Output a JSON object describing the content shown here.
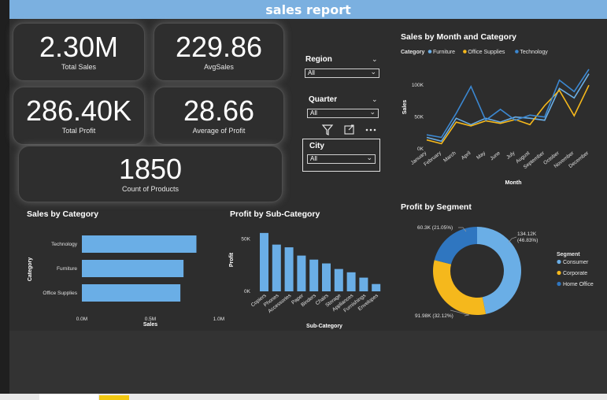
{
  "header": {
    "title": "sales report"
  },
  "kpis": {
    "total_sales": {
      "value": "2.30M",
      "label": "Total Sales"
    },
    "avg_sales": {
      "value": "229.86",
      "label": "AvgSales"
    },
    "total_profit": {
      "value": "286.40K",
      "label": "Total Profit"
    },
    "avg_profit": {
      "value": "28.66",
      "label": "Average of Profit"
    },
    "count_products": {
      "value": "1850",
      "label": "Count of Products"
    }
  },
  "slicers": {
    "region": {
      "label": "Region",
      "value": "All"
    },
    "quarter": {
      "label": "Quarter",
      "value": "All"
    },
    "city": {
      "label": "City",
      "value": "All"
    }
  },
  "icons": [
    "filter-icon",
    "focus-mode-icon",
    "more-options-icon",
    "chevron-down-icon"
  ],
  "colors": {
    "furniture": "#6aaee6",
    "office_supplies": "#f5b81c",
    "technology": "#3b87d0",
    "bar": "#6aaee6",
    "consumer": "#6aaee6",
    "corporate": "#f5b81c",
    "home_office": "#2f76c0"
  },
  "charts": {
    "month_category": {
      "title": "Sales by Month and Category",
      "legend_title": "Category",
      "legend": [
        "Furniture",
        "Office Supplies",
        "Technology"
      ],
      "xlabel": "Month",
      "ylabel": "Sales",
      "yticks": [
        "100K",
        "50K",
        "0K"
      ]
    },
    "category": {
      "title": "Sales by Category",
      "xlabel": "Sales",
      "ylabel": "Category",
      "xticks": [
        "0.0M",
        "0.5M",
        "1.0M"
      ]
    },
    "subcategory": {
      "title": "Profit by Sub-Category",
      "xlabel": "Sub-Category",
      "ylabel": "Profit",
      "yticks": [
        "50K",
        "0K"
      ]
    },
    "segment": {
      "title": "Profit by Segment",
      "legend_title": "Segment",
      "legend": [
        "Consumer",
        "Corporate",
        "Home Office"
      ],
      "labels": {
        "consumer": "134.12K\n(46.83%)",
        "corporate": "91.98K (32.12%)",
        "home_office": "60.3K (21.05%)"
      }
    }
  },
  "chart_data": [
    {
      "type": "line",
      "title": "Sales by Month and Category",
      "xlabel": "Month",
      "ylabel": "Sales",
      "x": [
        "January",
        "February",
        "March",
        "April",
        "May",
        "June",
        "July",
        "August",
        "September",
        "October",
        "November",
        "December"
      ],
      "ylim": [
        0,
        130000
      ],
      "series": [
        {
          "name": "Furniture",
          "values": [
            18000,
            12000,
            48000,
            38000,
            48000,
            42000,
            50000,
            48000,
            45000,
            95000,
            80000,
            118000
          ]
        },
        {
          "name": "Office Supplies",
          "values": [
            14000,
            8000,
            42000,
            36000,
            44000,
            40000,
            46000,
            38000,
            68000,
            92000,
            52000,
            100000
          ]
        },
        {
          "name": "Technology",
          "values": [
            22000,
            18000,
            56000,
            98000,
            45000,
            62000,
            45000,
            53000,
            50000,
            108000,
            90000,
            125000
          ]
        }
      ],
      "legend": "top"
    },
    {
      "type": "bar",
      "orientation": "horizontal",
      "title": "Sales by Category",
      "xlabel": "Sales",
      "ylabel": "Category",
      "categories": [
        "Technology",
        "Furniture",
        "Office Supplies"
      ],
      "values": [
        836154,
        741999,
        719047
      ],
      "xlim": [
        0,
        1000000
      ]
    },
    {
      "type": "bar",
      "title": "Profit by Sub-Category",
      "xlabel": "Sub-Category",
      "ylabel": "Profit",
      "categories": [
        "Copiers",
        "Phones",
        "Accessories",
        "Paper",
        "Binders",
        "Chairs",
        "Storage",
        "Appliances",
        "Furnishings",
        "Envelopes"
      ],
      "values": [
        55618,
        44516,
        41937,
        34054,
        30222,
        26590,
        21279,
        18138,
        13059,
        6964
      ],
      "ylim": [
        0,
        60000
      ]
    },
    {
      "type": "pie",
      "title": "Profit by Segment",
      "categories": [
        "Consumer",
        "Corporate",
        "Home Office"
      ],
      "values": [
        134120,
        91980,
        60300
      ],
      "percent": [
        46.83,
        32.12,
        21.05
      ]
    }
  ]
}
